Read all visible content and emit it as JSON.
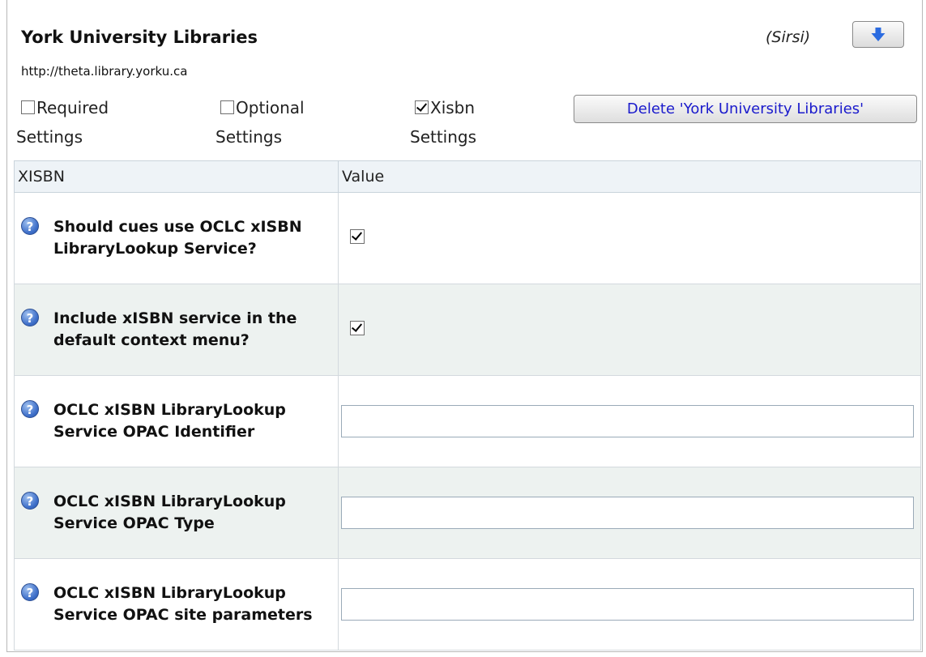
{
  "library": {
    "name": "York University Libraries",
    "url": "http://theta.library.yorku.ca",
    "ils": "(Sirsi)",
    "delete_label": "Delete 'York University Libraries'"
  },
  "options": [
    {
      "label_line1": "Required",
      "label_line2": "Settings",
      "checked": false
    },
    {
      "label_line1": "Optional",
      "label_line2": "Settings",
      "checked": false
    },
    {
      "label_line1": "Xisbn",
      "label_line2": "Settings",
      "checked": true
    }
  ],
  "table": {
    "headers": [
      "XISBN",
      "Value"
    ],
    "rows": [
      {
        "label": "Should cues use OCLC xISBN LibraryLookup Service?",
        "type": "checkbox",
        "checked": true
      },
      {
        "label": "Include xISBN service in the default context menu?",
        "type": "checkbox",
        "checked": true
      },
      {
        "label": "OCLC xISBN LibraryLookup Service OPAC Identifier",
        "type": "text",
        "value": ""
      },
      {
        "label": "OCLC xISBN LibraryLookup Service OPAC Type",
        "type": "text",
        "value": ""
      },
      {
        "label": "OCLC xISBN LibraryLookup Service OPAC site parameters",
        "type": "text",
        "value": ""
      }
    ]
  },
  "icons": {
    "move": "arrow-down-icon",
    "help": "help-icon"
  },
  "colors": {
    "delete_text": "#1a1acc",
    "help_icon": "#3e6fc9",
    "alt_row": "#edf2f0"
  }
}
